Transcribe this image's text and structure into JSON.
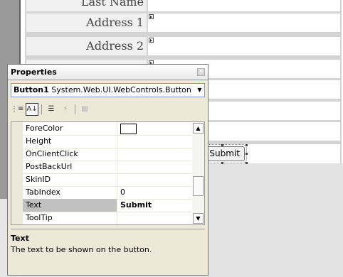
{
  "form": {
    "rows": [
      {
        "label": "Last Name"
      },
      {
        "label": "Address 1"
      },
      {
        "label": "Address 2"
      },
      {
        "label": ""
      },
      {
        "label": ""
      },
      {
        "label": ""
      },
      {
        "label": ""
      }
    ],
    "submit_label": "Submit"
  },
  "properties": {
    "title": "Properties",
    "close_glyph": "✕",
    "selector": {
      "name": "Button1",
      "type": "System.Web.UI.WebControls.Button"
    },
    "toolbar": {
      "categorized": "⋮≡",
      "alphabetical": "A↓",
      "properties": "☰",
      "events": "⚡",
      "property_pages": "▤"
    },
    "rows": [
      {
        "name": "ForeColor",
        "value": ""
      },
      {
        "name": "Height",
        "value": ""
      },
      {
        "name": "OnClientClick",
        "value": ""
      },
      {
        "name": "PostBackUrl",
        "value": ""
      },
      {
        "name": "SkinID",
        "value": ""
      },
      {
        "name": "TabIndex",
        "value": "0"
      },
      {
        "name": "Text",
        "value": "Submit"
      },
      {
        "name": "ToolTip",
        "value": ""
      }
    ],
    "description": {
      "title": "Text",
      "text": "The text to be shown on the button."
    }
  }
}
